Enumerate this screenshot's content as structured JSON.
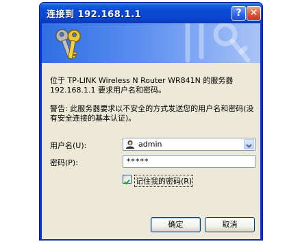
{
  "window": {
    "title": "连接到 192.168.1.1",
    "help_label": "?",
    "close_label": "✕"
  },
  "banner": {
    "icon": "keys-icon"
  },
  "message": {
    "line1": "位于 TP-LINK Wireless N Router WR841N 的服务器 192.168.1.1 要求用户名和密码。",
    "line2": "警告: 此服务器要求以不安全的方式发送您的用户名和密码(没有安全连接的基本认证)。"
  },
  "form": {
    "username_label": "用户名(U):",
    "username_value": "admin",
    "password_label": "密码(P):",
    "password_value": "*****",
    "remember_label": "记住我的密码(R)",
    "remember_checked": true
  },
  "buttons": {
    "ok": "确定",
    "cancel": "取消"
  },
  "colors": {
    "titlebar": "#0a4ad6",
    "dialog_bg": "#ece9d8",
    "banner": "#2f6ee2"
  }
}
